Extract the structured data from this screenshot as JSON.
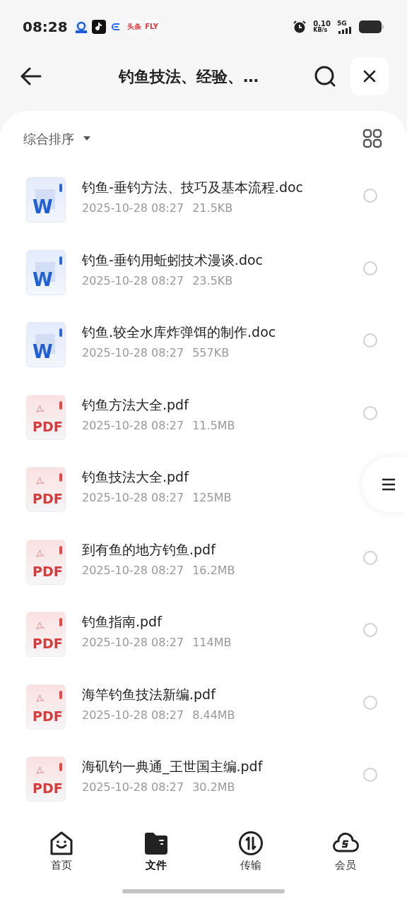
{
  "status_bar": {
    "time": "08:28",
    "app_icons": [
      {
        "kind": "circle"
      },
      {
        "kind": "note"
      },
      {
        "kind": "letter"
      },
      {
        "kind": "label",
        "text": "头条"
      },
      {
        "kind": "label",
        "text": "FLY"
      }
    ],
    "speed": "0.10",
    "speed_unit": "KB/s",
    "network": "5G"
  },
  "header": {
    "title": "钓鱼技法、经验、…"
  },
  "toolbar": {
    "sort": "综合排序"
  },
  "files": [
    {
      "kind": "doc",
      "icon_label": "W",
      "name": "钓鱼-垂钓方法、技巧及基本流程.doc",
      "date": "2025-10-28 08:27",
      "size": "21.5KB",
      "selected": false
    },
    {
      "kind": "doc",
      "icon_label": "W",
      "name": "钓鱼-垂钓用蚯蚓技术漫谈.doc",
      "date": "2025-10-28 08:27",
      "size": "23.5KB",
      "selected": false
    },
    {
      "kind": "doc",
      "icon_label": "W",
      "name": "钓鱼.较全水库炸弹饵的制作.doc",
      "date": "2025-10-28 08:27",
      "size": "557KB",
      "selected": false
    },
    {
      "kind": "pdf",
      "icon_label": "PDF",
      "name": "钓鱼方法大全.pdf",
      "date": "2025-10-28 08:27",
      "size": "11.5MB",
      "selected": false
    },
    {
      "kind": "pdf",
      "icon_label": "PDF",
      "name": "钓鱼技法大全.pdf",
      "date": "2025-10-28 08:27",
      "size": "125MB"
    },
    {
      "kind": "pdf",
      "icon_label": "PDF",
      "name": "到有鱼的地方钓鱼.pdf",
      "date": "2025-10-28 08:27",
      "size": "16.2MB",
      "selected": false
    },
    {
      "kind": "pdf",
      "icon_label": "PDF",
      "name": "钓鱼指南.pdf",
      "date": "2025-10-28 08:27",
      "size": "114MB",
      "selected": false
    },
    {
      "kind": "pdf",
      "icon_label": "PDF",
      "name": "海竿钓鱼技法新编.pdf",
      "date": "2025-10-28 08:27",
      "size": "8.44MB",
      "selected": false
    },
    {
      "kind": "pdf",
      "icon_label": "PDF",
      "name": "海矶钓一典通_王世国主编.pdf",
      "date": "2025-10-28 08:27",
      "size": "30.2MB",
      "selected": false
    }
  ],
  "bottom_nav": [
    {
      "kind": "home",
      "label": "首页",
      "selected": false
    },
    {
      "kind": "folder",
      "label": "文件",
      "selected": true
    },
    {
      "kind": "transfer",
      "label": "传输",
      "selected": false
    },
    {
      "kind": "vip",
      "label": "会员",
      "selected": false
    }
  ]
}
